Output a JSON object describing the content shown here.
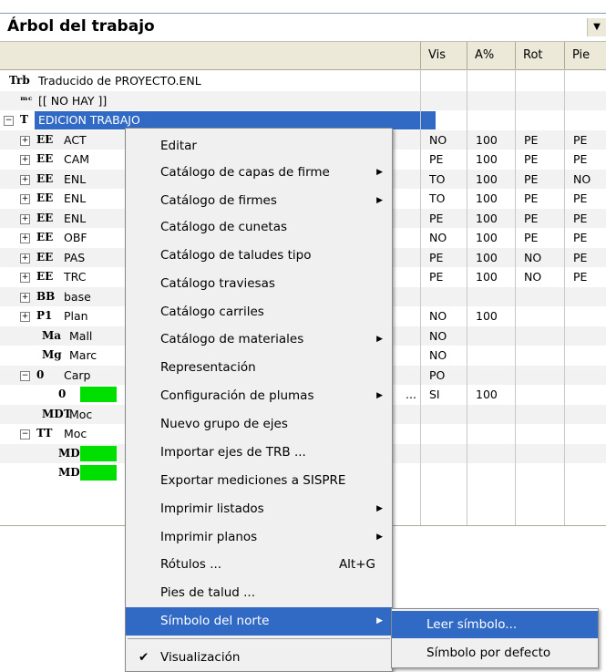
{
  "title": "Árbol del trabajo",
  "columns": [
    "Vis",
    "A%",
    "Rot",
    "Pie"
  ],
  "tree": [
    {
      "icon": "Trb",
      "label": "Traducido de PROYECTO.ENL"
    },
    {
      "icon": "ᵐᶜ",
      "label": "[[ NO HAY ]]"
    },
    {
      "icon": "T",
      "label": "EDICION TRABAJO"
    },
    {
      "icon": "EE",
      "label": "ACT"
    },
    {
      "icon": "EE",
      "label": "CAM"
    },
    {
      "icon": "EE",
      "label": "ENL"
    },
    {
      "icon": "EE",
      "label": "ENL"
    },
    {
      "icon": "EE",
      "label": "ENL"
    },
    {
      "icon": "EE",
      "label": "OBF"
    },
    {
      "icon": "EE",
      "label": "PAS"
    },
    {
      "icon": "EE",
      "label": "TRC"
    },
    {
      "icon": "BB",
      "label": "base"
    },
    {
      "icon": "P1",
      "label": "Plan"
    },
    {
      "icon": "Ma",
      "label": "Mall"
    },
    {
      "icon": "Mg",
      "label": "Marc"
    },
    {
      "icon": "0",
      "label": "Carp"
    },
    {
      "icon": "0",
      "label": ""
    },
    {
      "icon": "MDT",
      "label": "Moc"
    },
    {
      "icon": "TT",
      "label": "Moc"
    },
    {
      "icon": "MD",
      "label": ""
    },
    {
      "icon": "MD",
      "label": ""
    }
  ],
  "grid": [
    [
      "",
      "",
      "",
      ""
    ],
    [
      "",
      "",
      "",
      ""
    ],
    [
      "",
      "",
      "",
      ""
    ],
    [
      "NO",
      "100",
      "PE",
      "PE"
    ],
    [
      "PE",
      "100",
      "PE",
      "PE"
    ],
    [
      "TO",
      "100",
      "PE",
      "NO"
    ],
    [
      "TO",
      "100",
      "PE",
      "PE"
    ],
    [
      "PE",
      "100",
      "PE",
      "PE"
    ],
    [
      "NO",
      "100",
      "PE",
      "PE"
    ],
    [
      "PE",
      "100",
      "NO",
      "PE"
    ],
    [
      "PE",
      "100",
      "NO",
      "PE"
    ],
    [
      "",
      "",
      "",
      ""
    ],
    [
      "NO",
      "100",
      "",
      ""
    ],
    [
      "NO",
      "",
      "",
      ""
    ],
    [
      "NO",
      "",
      "",
      ""
    ],
    [
      "PO",
      "",
      "",
      ""
    ],
    [
      "SI",
      "100",
      "",
      ""
    ],
    [
      "",
      "",
      "",
      ""
    ],
    [
      "",
      "",
      "",
      ""
    ],
    [
      "",
      "",
      "",
      ""
    ],
    [
      "",
      "",
      "",
      ""
    ]
  ],
  "truncation": "...",
  "menu": [
    {
      "label": "Editar",
      "arrow": false
    },
    {
      "label": "Catálogo de capas de firme",
      "arrow": true
    },
    {
      "label": "Catálogo de firmes",
      "arrow": true
    },
    {
      "label": "Catálogo de cunetas",
      "arrow": false
    },
    {
      "label": "Catálogo de taludes tipo",
      "arrow": false
    },
    {
      "label": "Catálogo traviesas",
      "arrow": false
    },
    {
      "label": "Catálogo carriles",
      "arrow": false
    },
    {
      "label": "Catálogo de materiales",
      "arrow": true
    },
    {
      "label": "Representación",
      "arrow": false
    },
    {
      "label": "Configuración de plumas",
      "arrow": true
    },
    {
      "label": "Nuevo grupo de ejes",
      "arrow": false
    },
    {
      "label": "Importar ejes de TRB ...",
      "arrow": false
    },
    {
      "label": "Exportar mediciones a SISPRE",
      "arrow": false
    },
    {
      "label": "Imprimir listados",
      "arrow": true
    },
    {
      "label": "Imprimir planos",
      "arrow": true
    },
    {
      "label": "Rótulos ...",
      "arrow": false,
      "accel": "Alt+G"
    },
    {
      "label": "Pies de talud ...",
      "arrow": false
    },
    {
      "label": "Símbolo del norte",
      "arrow": true,
      "highlighted": true
    },
    {
      "label": "Visualización",
      "arrow": false,
      "checked": true
    }
  ],
  "submenu": [
    {
      "label": "Leer símbolo...",
      "highlighted": true
    },
    {
      "label": "Símbolo por defecto",
      "highlighted": false
    }
  ],
  "icons": {
    "dropdown": "dropdown-arrow-icon",
    "arrow": "submenu-arrow-icon",
    "check": "checkmark-icon"
  },
  "colors": {
    "selection": "#316ac5",
    "green": "#00e000"
  }
}
